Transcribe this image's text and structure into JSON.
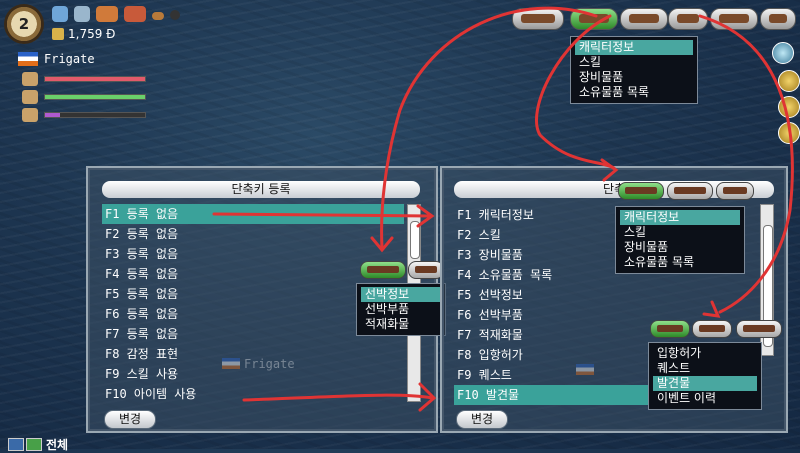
{
  "hud": {
    "level": "2",
    "money": "1,759 Đ",
    "ship_name": "Frigate",
    "bars": [
      {
        "name": "durability",
        "fill": 1.0,
        "color": "#e25a6a"
      },
      {
        "name": "crew",
        "fill": 1.0,
        "color": "#6ad06a"
      },
      {
        "name": "food",
        "fill": 0.15,
        "color": "#b05ad0"
      }
    ]
  },
  "top_menu": {
    "items": [
      "캐릭터정보",
      "스킬",
      "장비물품",
      "소유물품 목록"
    ],
    "selected": 0
  },
  "left_panel": {
    "title": "단축키 등록",
    "rows": [
      "F1 등록 없음",
      "F2 등록 없음",
      "F3 등록 없음",
      "F4 등록 없음",
      "F5 등록 없음",
      "F6 등록 없음",
      "F7 등록 없음",
      "F8 감정 표현",
      "F9 스킬 사용",
      "F10 아이템 사용"
    ],
    "selected": 0,
    "change_button": "변경",
    "watermark": "Frigate"
  },
  "left_menu": {
    "items": [
      "선박정보",
      "선박부품",
      "적재화물"
    ],
    "selected": 0
  },
  "right_panel": {
    "title": "단축",
    "rows": [
      "F1 캐릭터정보",
      "F2 스킬",
      "F3 장비물품",
      "F4 소유물품 목록",
      "F5 선박정보",
      "F6 선박부품",
      "F7 적재화물",
      "F8 입항허가",
      "F9 퀘스트",
      "F10 발견물"
    ],
    "selected": 9,
    "change_button": "변경"
  },
  "right_menu_1": {
    "items": [
      "캐릭터정보",
      "스킬",
      "장비물품",
      "소유물품 목록"
    ],
    "selected": 0
  },
  "right_menu_2": {
    "items": [
      "입항허가",
      "퀘스트",
      "발견물",
      "이벤트 이력"
    ],
    "selected": 2
  },
  "bottom_left": {
    "label": "전체"
  },
  "colors": {
    "highlight": "#3aa29a",
    "arrow": "#e03434"
  }
}
